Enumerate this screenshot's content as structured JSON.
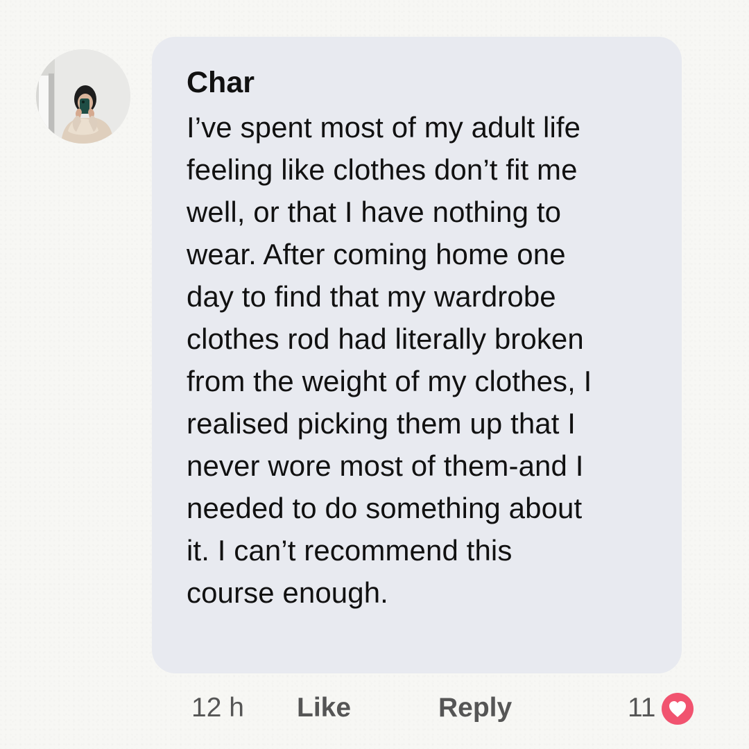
{
  "comment": {
    "author": "Char",
    "text": "I’ve spent most of my adult life\nfeeling like clothes don’t fit me\nwell, or that I have nothing to\nwear. After coming home one\nday to find that my wardrobe\nclothes rod had literally broken\nfrom the weight of my clothes, I\nrealised picking them up that I\nnever wore most of them-and I\nneeded to do something about\nit. I can’t recommend this\ncourse enough."
  },
  "actions": {
    "timestamp": "12 h",
    "like_label": "Like",
    "reply_label": "Reply",
    "reaction_count": "11"
  },
  "icons": {
    "reaction": "heart-icon",
    "profile": "avatar-photo"
  },
  "colors": {
    "background": "#f7f7f4",
    "bubble": "#e8eaf0",
    "text": "#111111",
    "secondary_text": "#555555",
    "reaction_heart": "#f1536f"
  }
}
